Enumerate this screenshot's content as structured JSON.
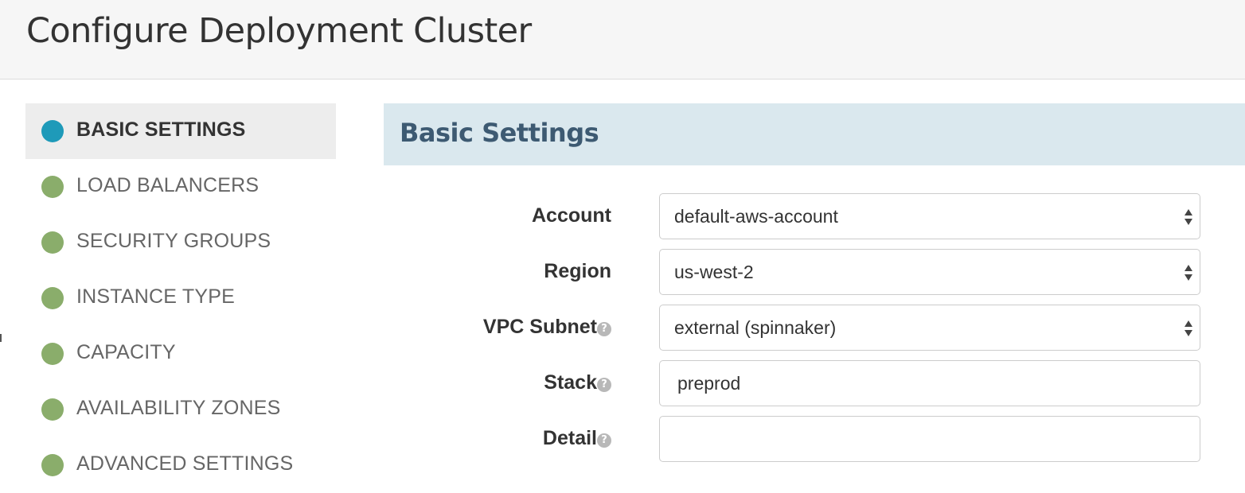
{
  "header": {
    "title": "Configure Deployment Cluster"
  },
  "nav": {
    "items": [
      {
        "label": "BASIC SETTINGS",
        "active": true
      },
      {
        "label": "LOAD BALANCERS"
      },
      {
        "label": "SECURITY GROUPS"
      },
      {
        "label": "INSTANCE TYPE"
      },
      {
        "label": "CAPACITY"
      },
      {
        "label": "AVAILABILITY ZONES"
      },
      {
        "label": "ADVANCED SETTINGS"
      }
    ]
  },
  "panel": {
    "title": "Basic Settings"
  },
  "form": {
    "account": {
      "label": "Account",
      "value": "default-aws-account"
    },
    "region": {
      "label": "Region",
      "value": "us-west-2"
    },
    "vpc_subnet": {
      "label": "VPC Subnet",
      "value": "external (spinnaker)"
    },
    "stack": {
      "label": "Stack",
      "value": "preprod"
    },
    "detail": {
      "label": "Detail",
      "value": ""
    },
    "help_glyph": "?"
  },
  "colors": {
    "active_dot": "#1e9ab9",
    "inactive_dot": "#8aad6b",
    "panel_header_bg": "#dae8ee",
    "panel_title": "#3d5a72"
  },
  "icons": {
    "nav_status": "status-dot-icon",
    "help": "question-circle-icon",
    "select_caret": "sort-arrows-icon"
  }
}
